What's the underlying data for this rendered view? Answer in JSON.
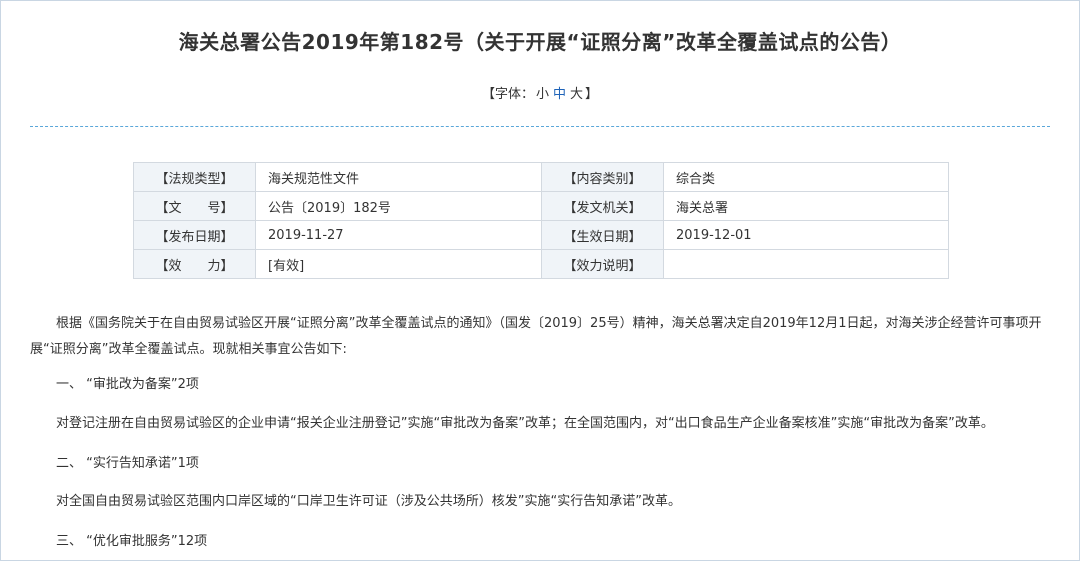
{
  "document": {
    "title": "海关总署公告2019年第182号（关于开展“证照分离”改革全覆盖试点的公告）",
    "font_size": {
      "prefix": "【字体：",
      "small": "小",
      "medium": "中",
      "large": "大",
      "suffix": "】"
    }
  },
  "meta": [
    {
      "k1": "【法规类型】",
      "v1": "海关规范性文件",
      "k2": "【内容类别】",
      "v2": "综合类"
    },
    {
      "k1": "【文　　号】",
      "v1": "公告〔2019〕182号",
      "k2": "【发文机关】",
      "v2": "海关总署"
    },
    {
      "k1": "【发布日期】",
      "v1": "2019-11-27",
      "k2": "【生效日期】",
      "v2": "2019-12-01"
    },
    {
      "k1": "【效　　力】",
      "v1": "[有效]",
      "k2": "【效力说明】",
      "v2": ""
    }
  ],
  "body": {
    "intro": "根据《国务院关于在自由贸易试验区开展“证照分离”改革全覆盖试点的通知》（国发〔2019〕25号）精神，海关总署决定自2019年12月1日起，对海关涉企经营许可事项开展“证照分离”改革全覆盖试点。现就相关事宜公告如下:",
    "s1_head": "一、 “审批改为备案”2项",
    "s1_text": "对登记注册在自由贸易试验区的企业申请“报关企业注册登记”实施“审批改为备案”改革；在全国范围内，对“出口食品生产企业备案核准”实施“审批改为备案”改革。",
    "s2_head": "二、 “实行告知承诺”1项",
    "s2_text": "对全国自由贸易试验区范围内口岸区域的“口岸卫生许可证（涉及公共场所）核发”实施“实行告知承诺”改革。",
    "s3_head": "三、 “优化审批服务”12项"
  }
}
